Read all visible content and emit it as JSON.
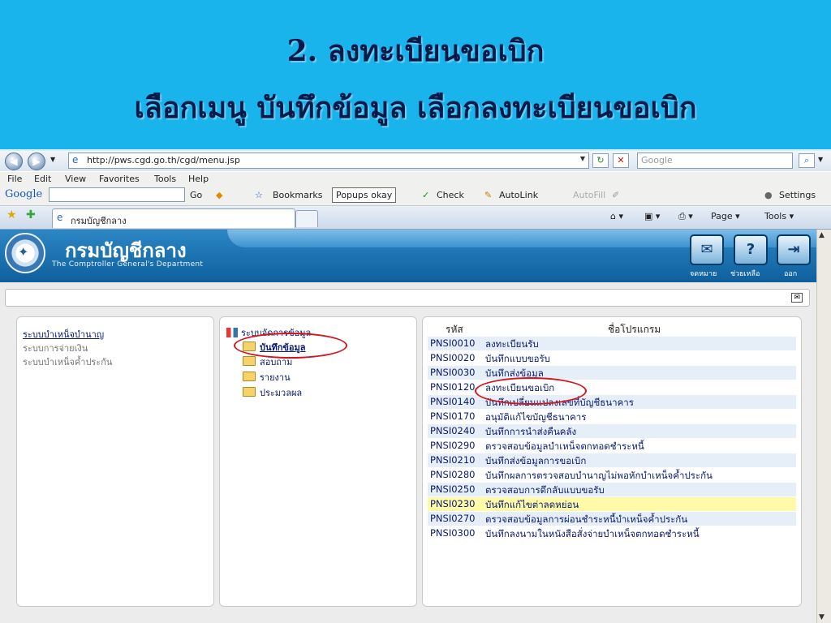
{
  "banner": {
    "line1": "2. ลงทะเบียนขอเบิก",
    "line2": "เลือกเมนู บันทึกข้อมูล  เลือกลงทะเบียนขอเบิก"
  },
  "browser": {
    "url": "http://pws.cgd.go.th/cgd/menu.jsp",
    "search_placeholder": "Google",
    "menu": [
      "File",
      "Edit",
      "View",
      "Favorites",
      "Tools",
      "Help"
    ],
    "google_bar": {
      "brand": "Google",
      "go": "Go",
      "bookmarks": "Bookmarks",
      "popups": "Popups okay",
      "check": "Check",
      "autolink": "AutoLink",
      "autofill": "AutoFill",
      "settings": "Settings"
    },
    "tab_title": "กรมบัญชีกลาง",
    "right_tools": {
      "page": "Page",
      "tools": "Tools"
    }
  },
  "app": {
    "title": "กรมบัญชีกลาง",
    "subtitle": "The Comptroller General's Department",
    "icons": [
      {
        "label": "จดหมาย"
      },
      {
        "label": "ช่วยเหลือ"
      },
      {
        "label": "ออก"
      }
    ]
  },
  "systems": [
    "ระบบบำเหน็จบำนาญ",
    "ระบบการจ่ายเงิน",
    "ระบบบำเหน็จค้ำประกัน"
  ],
  "tree": {
    "root": "ระบบจัดการข้อมูล",
    "items": [
      "บันทึกข้อมูล",
      "สอบถาม",
      "รายงาน",
      "ประมวลผล"
    ]
  },
  "programs": {
    "col_code": "รหัส",
    "col_name": "ชื่อโปรแกรม",
    "rows": [
      {
        "code": "PNSI0010",
        "name": "ลงทะเบียนรับ"
      },
      {
        "code": "PNSI0020",
        "name": "บันทึกแบบขอรับ"
      },
      {
        "code": "PNSI0030",
        "name": "บันทึกส่งข้อมูล"
      },
      {
        "code": "PNSI0120",
        "name": "ลงทะเบียนขอเบิก"
      },
      {
        "code": "PNSI0140",
        "name": "บันทึกเปลี่ยนแปลงเลขที่บัญชีธนาคาร"
      },
      {
        "code": "PNSI0170",
        "name": "อนุมัติแก้ไขบัญชีธนาคาร"
      },
      {
        "code": "PNSI0240",
        "name": "บันทึกการนำส่งคืนคลัง"
      },
      {
        "code": "PNSI0290",
        "name": "ตรวจสอบข้อมูลบำเหน็จตกทอดชำระหนี้"
      },
      {
        "code": "PNSI0210",
        "name": "บันทึกส่งข้อมูลการขอเบิก"
      },
      {
        "code": "PNSI0280",
        "name": "บันทึกผลการตรวจสอบบำนาญไม่พอหักบำเหน็จค้ำประกัน"
      },
      {
        "code": "PNSI0250",
        "name": "ตรวจสอบการดึกลับแบบขอรับ"
      },
      {
        "code": "PNSI0230",
        "name": "บันทึกแก้ไขต่าลดหย่อน"
      },
      {
        "code": "PNSI0270",
        "name": "ตรวจสอบข้อมูลการผ่อนชำระหนี้บำเหน็จค้ำประกัน"
      },
      {
        "code": "PNSI0300",
        "name": "บันทึกลงนามในหนังสือสั่งจ่ายบำเหน็จตกทอดชำระหนี้"
      }
    ]
  }
}
